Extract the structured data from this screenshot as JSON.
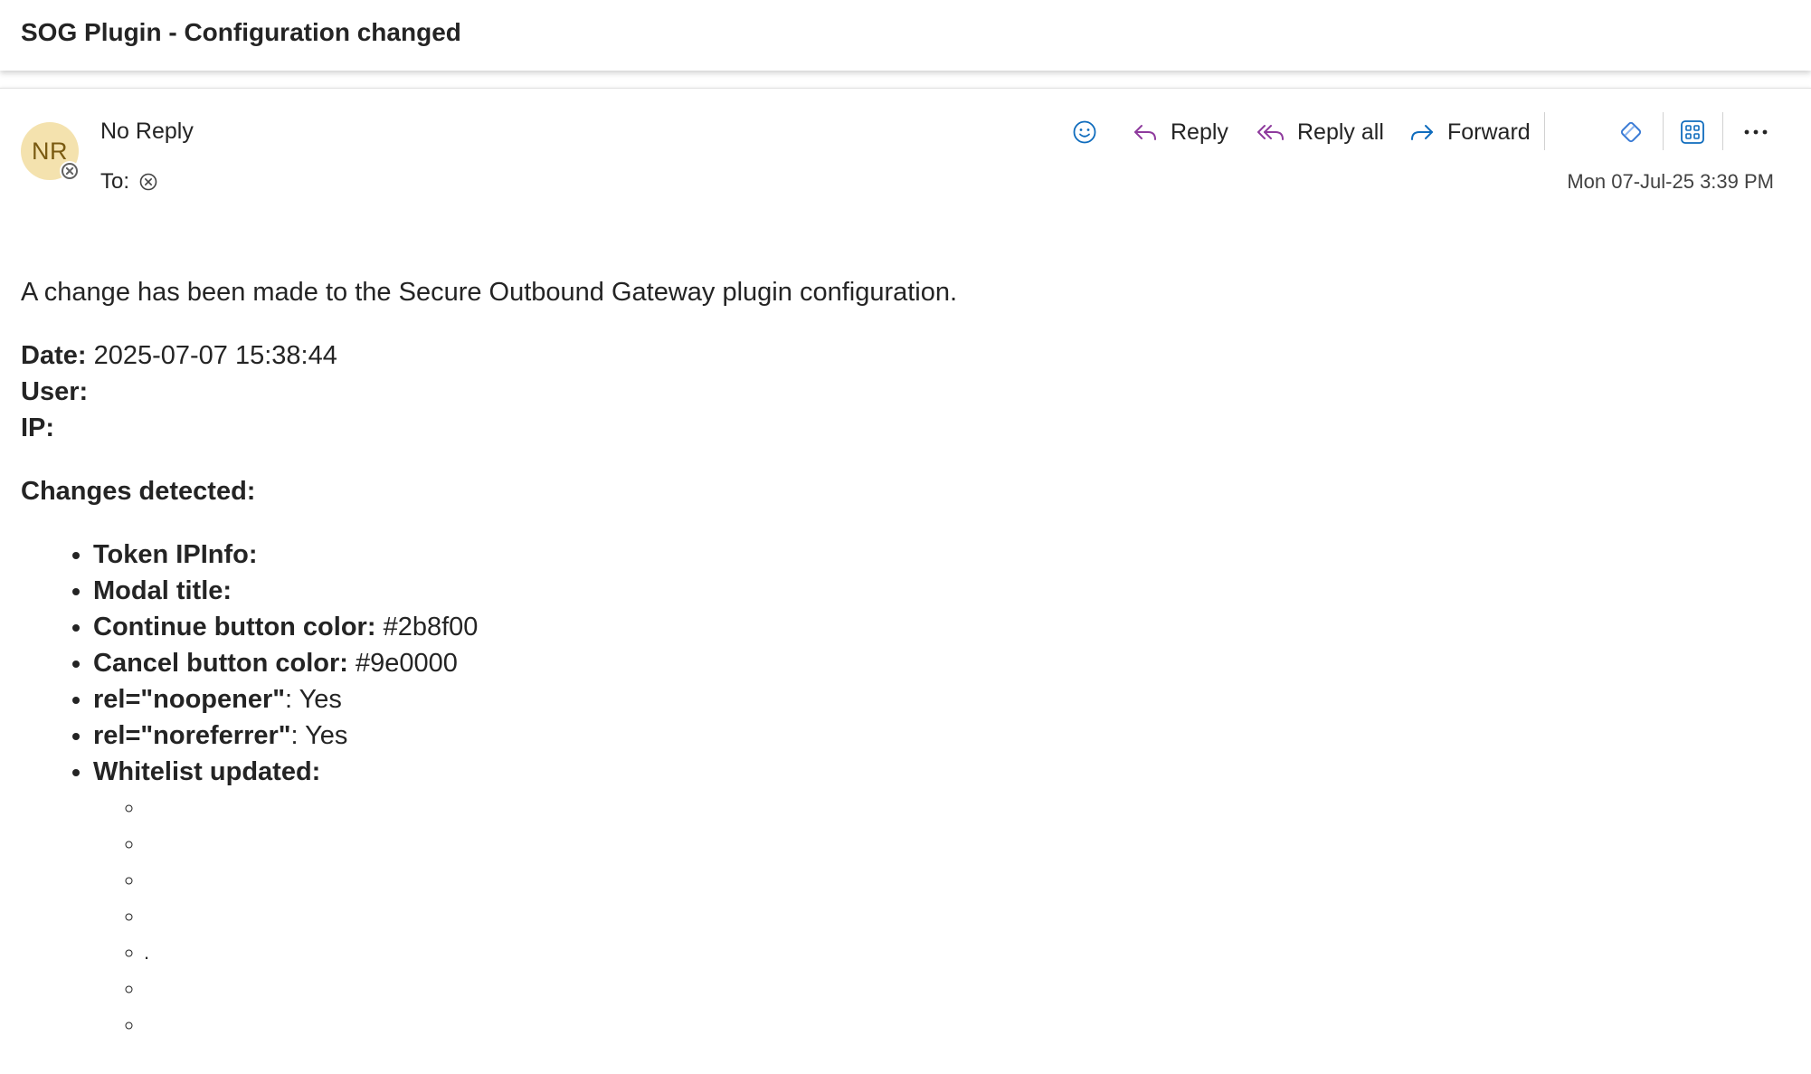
{
  "subject": "SOG Plugin - Configuration changed",
  "sender": {
    "initials": "NR",
    "name": "No Reply",
    "to_label": "To:"
  },
  "toolbar": {
    "reply_label": "Reply",
    "reply_all_label": "Reply all",
    "forward_label": "Forward"
  },
  "timestamp": "Mon 07-Jul-25 3:39 PM",
  "body": {
    "intro": "A change has been made to the Secure Outbound Gateway plugin configuration.",
    "date_label": "Date:",
    "date_value": "2025-07-07 15:38:44",
    "user_label": "User:",
    "ip_label": "IP:",
    "changes_title": "Changes detected:",
    "changes": [
      {
        "label": "Token IPInfo:",
        "value": ""
      },
      {
        "label": "Modal title:",
        "value": ""
      },
      {
        "label": "Continue button color:",
        "value": "#2b8f00"
      },
      {
        "label": "Cancel button color:",
        "value": "#9e0000"
      },
      {
        "label": "rel=\"noopener\"",
        "value": ": Yes"
      },
      {
        "label": "rel=\"noreferrer\"",
        "value": ": Yes"
      },
      {
        "label": "Whitelist updated:",
        "value": ""
      }
    ],
    "whitelist": [
      "",
      "",
      "",
      "",
      ".",
      "",
      ""
    ]
  },
  "colors": {
    "accent": "#0f6cbd",
    "reply_icon": "#8e3a9d",
    "avatar_bg": "#f4e2ae",
    "avatar_text": "#7a5b12"
  }
}
